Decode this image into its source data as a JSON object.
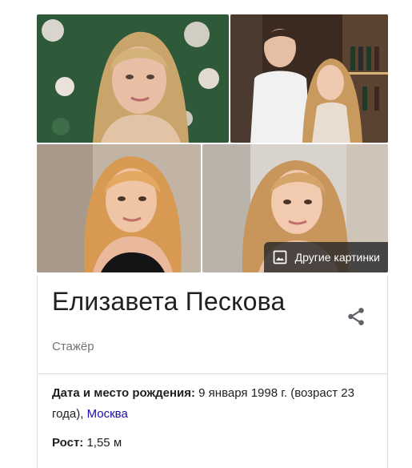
{
  "images": {
    "more_label": "Другие картинки",
    "more_icon": "image-icon"
  },
  "entity": {
    "title": "Елизавета Пескова",
    "subtitle": "Стажёр",
    "share_icon": "share-icon"
  },
  "facts": {
    "birth": {
      "label": "Дата и место рождения:",
      "value": "9 января 1998 г. (возраст 23 года),",
      "place": "Москва"
    },
    "height": {
      "label": "Рост:",
      "value": "1,55 м"
    }
  },
  "colors": {
    "link": "#1a0dab",
    "title": "#202124",
    "muted": "#70757a",
    "divider": "#dadce0"
  }
}
